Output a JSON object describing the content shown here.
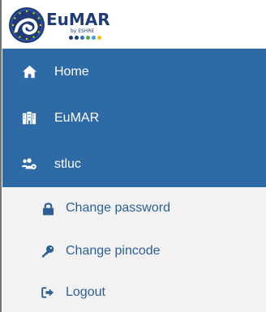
{
  "brand": {
    "name": "EuMAR",
    "tagline": "by ESHRE",
    "colors": {
      "navy": "#1f3b78",
      "gold": "#f2c200",
      "green": "#57a84a",
      "cyan": "#2ea7d6",
      "blue": "#2d6cc0"
    }
  },
  "nav": {
    "background": "#2e6aa6",
    "items": [
      {
        "label": "Home",
        "icon": "home-icon"
      },
      {
        "label": "EuMAR",
        "icon": "building-icon"
      },
      {
        "label": "stluc",
        "icon": "users-gear-icon"
      }
    ]
  },
  "submenu": {
    "background": "#f2f2f2",
    "text_color": "#2c5f95",
    "items": [
      {
        "label": "Change password",
        "icon": "lock-icon"
      },
      {
        "label": "Change pincode",
        "icon": "key-icon"
      },
      {
        "label": "Logout",
        "icon": "logout-icon"
      }
    ]
  }
}
